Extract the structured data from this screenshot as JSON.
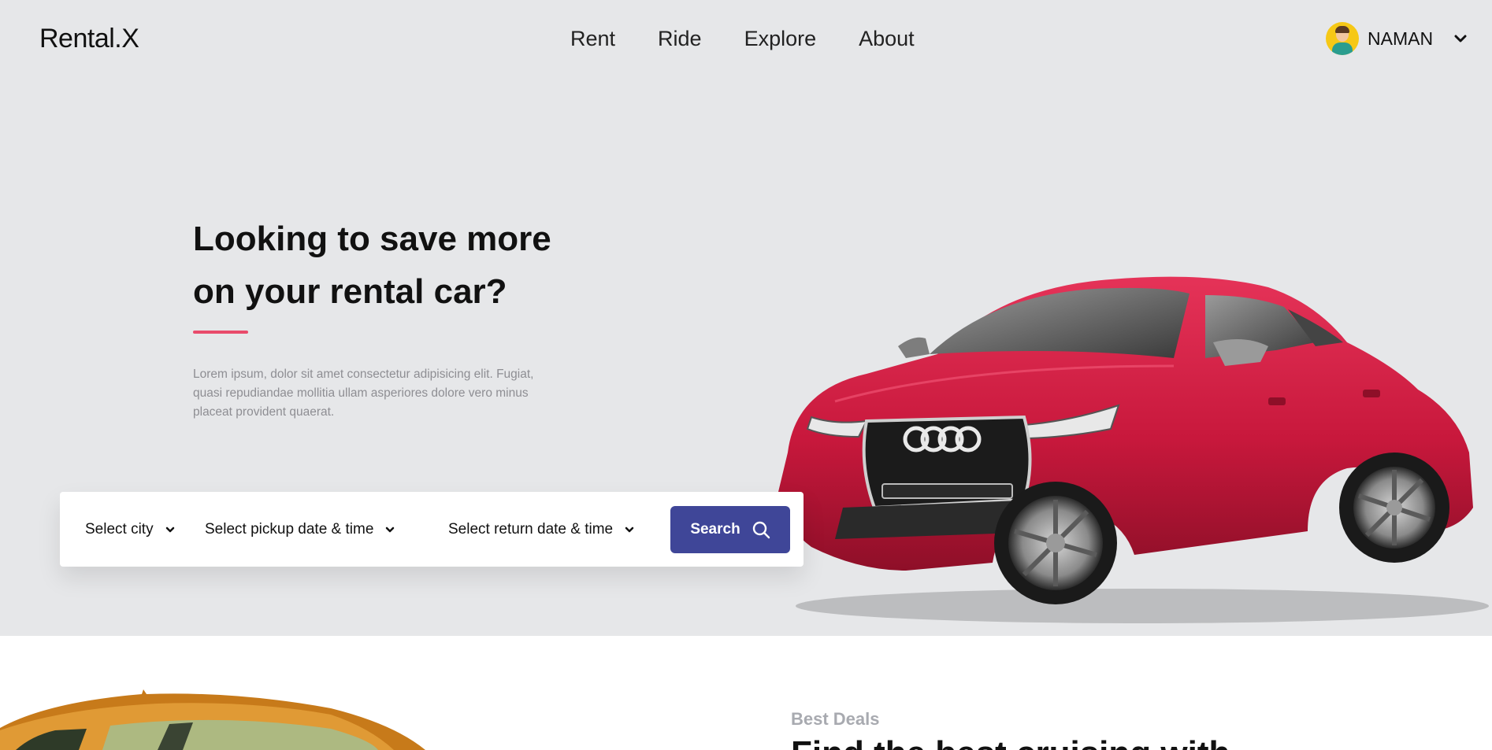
{
  "brand": {
    "logo": "Rental.X"
  },
  "nav": {
    "items": [
      {
        "label": "Rent"
      },
      {
        "label": "Ride"
      },
      {
        "label": "Explore"
      },
      {
        "label": "About"
      }
    ]
  },
  "user": {
    "name": "NAMAN",
    "avatar_icon": "user-avatar-icon",
    "menu_icon": "chevron-down-icon"
  },
  "hero": {
    "headline": "Looking to save more on your rental car?",
    "description": "Lorem ipsum, dolor sit amet consectetur adipisicing elit. Fugiat, quasi repudiandae mollitia ullam asperiores dolore vero minus placeat provident quaerat.",
    "accent_color": "#e94b6b",
    "background_color": "#e6e7e9",
    "image_icon": "red-sports-car-image"
  },
  "search": {
    "city_label": "Select city",
    "pickup_label": "Select pickup date & time",
    "return_label": "Select return date & time",
    "button_label": "Search",
    "button_color": "#3f4698",
    "button_icon": "search-icon"
  },
  "deals": {
    "eyebrow": "Best Deals",
    "heading": "Find the best cruising with"
  }
}
